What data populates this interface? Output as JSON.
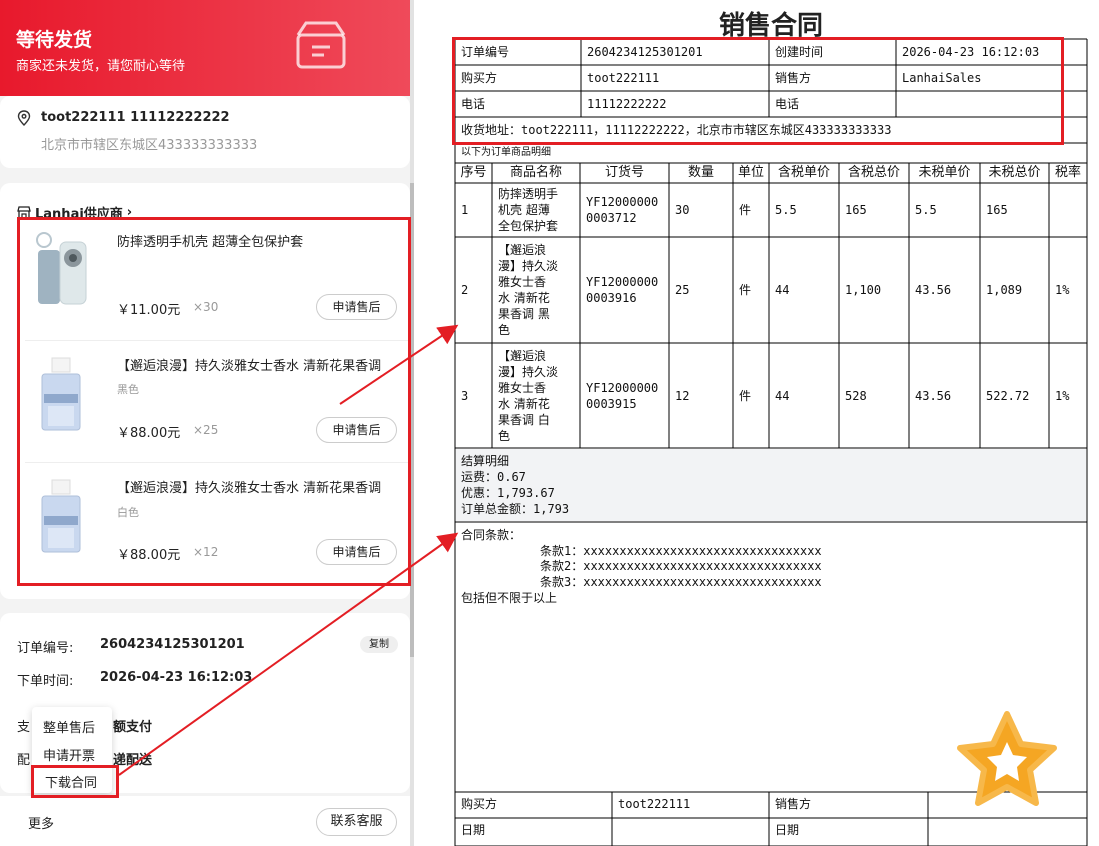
{
  "header": {
    "title": "等待发货",
    "subtitle": "商家还未发货，请您耐心等待"
  },
  "address": {
    "name_phone": "toot222111   11112222222",
    "line": "北京市市辖区东城区433333333333"
  },
  "shop": {
    "name": "Lanhai供应商",
    "chevron": "›"
  },
  "items": [
    {
      "title": "防摔透明手机壳 超薄全包保护套",
      "variant": "",
      "price": "￥11.00元",
      "qty": "×30",
      "button": "申请售后"
    },
    {
      "title": "【邂逅浪漫】持久淡雅女士香水 清新花果香调",
      "variant": "黑色",
      "price": "￥88.00元",
      "qty": "×25",
      "button": "申请售后"
    },
    {
      "title": "【邂逅浪漫】持久淡雅女士香水 清新花果香调",
      "variant": "白色",
      "price": "￥88.00元",
      "qty": "×12",
      "button": "申请售后"
    }
  ],
  "order_info": {
    "no_label": "订单编号:",
    "no_value": "2604234125301201",
    "copy": "复制",
    "time_label": "下单时间:",
    "time_value": "2026-04-23 16:12:03",
    "pay_label": "支",
    "pay_value": "额支付",
    "ship_label": "配",
    "ship_value": "递配送"
  },
  "menu": {
    "items": [
      "整单售后",
      "申请开票",
      "下载合同"
    ]
  },
  "bottom": {
    "more": "更多",
    "service": "联系客服"
  },
  "contract": {
    "title": "销售合同",
    "order_no_label": "订单编号",
    "order_no": "2604234125301201",
    "created_label": "创建时间",
    "created": "2026-04-23 16:12:03",
    "buyer_label": "购买方",
    "buyer": "toot222111",
    "seller_label": "销售方",
    "seller": "LanhaiSales",
    "phone_label": "电话",
    "phone": "11112222222",
    "phone2_label": "电话",
    "phone2": "",
    "shipping": "收货地址：toot222111，11112222222，北京市市辖区东城区433333333333",
    "list_caption": "以下为订单商品明细",
    "columns": [
      "序号",
      "商品名称",
      "订货号",
      "数量",
      "单位",
      "含税单价",
      "含税总价",
      "未税单价",
      "未税总价",
      "税率"
    ],
    "rows": [
      [
        "1",
        "防摔透明手\n机壳 超薄\n全包保护套",
        "YF12000000\n0003712",
        "30",
        "件",
        "5.5",
        "165",
        "5.5",
        "165",
        ""
      ],
      [
        "2",
        "【邂逅浪\n漫】持久淡\n雅女士香\n水 清新花\n果香调 黑\n色",
        "YF12000000\n0003916",
        "25",
        "件",
        "44",
        "1,100",
        "43.56",
        "1,089",
        "1%"
      ],
      [
        "3",
        "【邂逅浪\n漫】持久淡\n雅女士香\n水 清新花\n果香调 白\n色",
        "YF12000000\n0003915",
        "12",
        "件",
        "44",
        "528",
        "43.56",
        "522.72",
        "1%"
      ]
    ],
    "settle_title": "结算明细",
    "freight": "运费：0.67",
    "discount": "优惠：1,793.67",
    "total": "订单总金额：1,793",
    "terms_title": "合同条款：",
    "terms": [
      "条款1：xxxxxxxxxxxxxxxxxxxxxxxxxxxxxxxxx",
      "条款2：xxxxxxxxxxxxxxxxxxxxxxxxxxxxxxxxx",
      "条款3：xxxxxxxxxxxxxxxxxxxxxxxxxxxxxxxxx"
    ],
    "terms_footer": "包括但不限于以上",
    "sign_buyer_label": "购买方",
    "sign_buyer": "toot222111",
    "sign_seller_label": "销售方",
    "date_label": "日期",
    "date_label2": "日期"
  },
  "colors": {
    "header_red": "#e8192c",
    "annotation_red": "#e31e24",
    "star": "#f5a623"
  },
  "icons": [
    "location-icon",
    "box-icon",
    "shop-icon",
    "star-icon"
  ]
}
